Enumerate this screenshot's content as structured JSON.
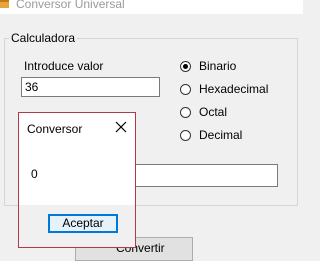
{
  "window": {
    "title": "Conversor Universal"
  },
  "calculator": {
    "group_title": "Calculadora",
    "input_label": "Introduce valor",
    "input_value": "36",
    "result_value": "",
    "radio_options": [
      {
        "label": "Binario",
        "selected": true
      },
      {
        "label": "Hexadecimal",
        "selected": false
      },
      {
        "label": "Octal",
        "selected": false
      },
      {
        "label": "Decimal",
        "selected": false
      }
    ],
    "convert_button_label": "Convertir"
  },
  "dialog": {
    "title": "Conversor",
    "message": "0",
    "accept_label": "Aceptar"
  },
  "colors": {
    "dialog_border": "#b03a48",
    "focus_blue": "#0078d7"
  },
  "icons": {
    "app_icon": "window-app-icon",
    "close": "close-icon",
    "radio_selected": "radio-selected",
    "radio_unselected": "radio-unselected"
  }
}
